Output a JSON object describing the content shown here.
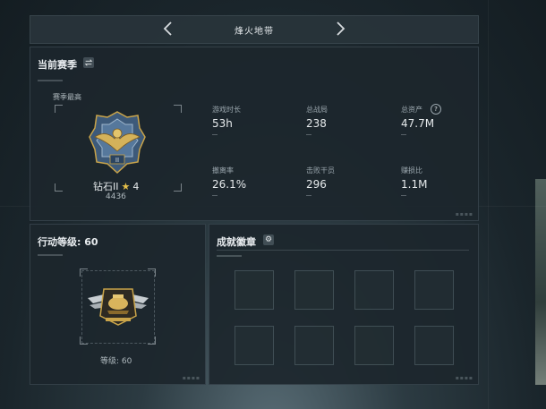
{
  "header": {
    "title": "烽火地带"
  },
  "season": {
    "title": "当前赛季",
    "best_label": "赛季最高",
    "rank_name": "钻石II",
    "rank_stars": "4",
    "rank_score": "4436",
    "stats": [
      {
        "label": "游戏时长",
        "value": "53h"
      },
      {
        "label": "总战局",
        "value": "238"
      },
      {
        "label": "总资产",
        "value": "47.7M",
        "help": "?"
      },
      {
        "label": "撤离率",
        "value": "26.1%"
      },
      {
        "label": "击败干员",
        "value": "296"
      },
      {
        "label": "赚损比",
        "value": "1.1M"
      }
    ]
  },
  "action_level": {
    "title": "行动等级: 60",
    "level_text": "等级: 60"
  },
  "achievements": {
    "title": "成就徽章",
    "slots": 8
  },
  "icons": {
    "prev": "chevron-left-icon",
    "next": "chevron-right-icon",
    "swap": "swap-icon",
    "settings": "gear-icon",
    "help": "help-icon",
    "star": "star-icon"
  },
  "colors": {
    "accent_gold": "#c9a44a",
    "rank_blue": "#4a6a8c"
  }
}
